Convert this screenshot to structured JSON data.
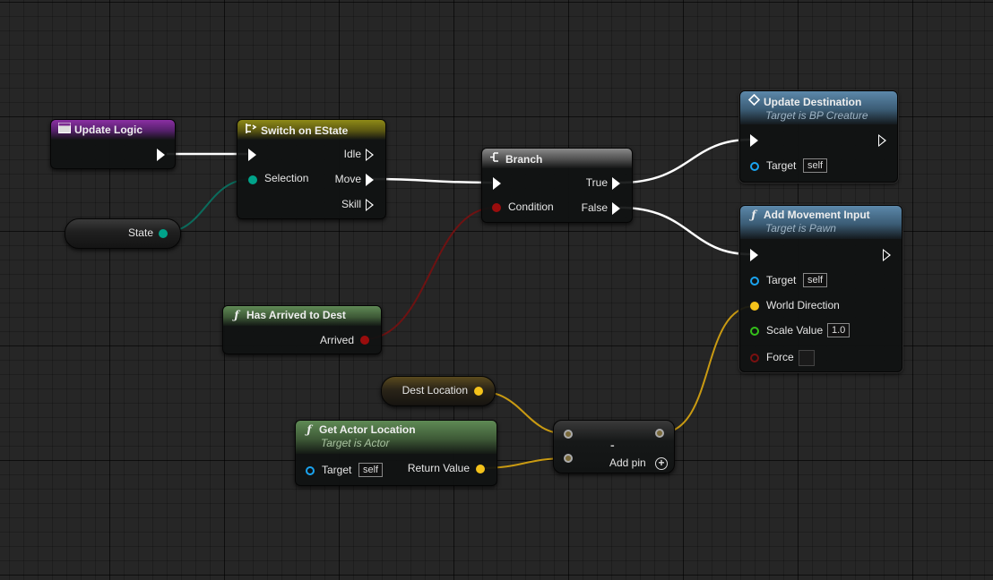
{
  "colors": {
    "exec": "#ffffff",
    "state_pin": "#00a38a",
    "bool_pin": "#9a0d0d",
    "vector_pin": "#f4c21b",
    "object_pin": "#1aa4f0",
    "float_pin": "#34c01a",
    "bool_pin_dark": "#7a1010"
  },
  "nodes": {
    "update_logic": {
      "title": "Update Logic",
      "icon": "event-icon"
    },
    "switch": {
      "title": "Switch on EState",
      "icon": "switch-icon",
      "pins": {
        "selection": "Selection",
        "idle": "Idle",
        "move": "Move",
        "skill": "Skill"
      }
    },
    "state_var": {
      "label": "State"
    },
    "branch": {
      "title": "Branch",
      "icon": "branch-icon",
      "pins": {
        "condition": "Condition",
        "true": "True",
        "false": "False"
      }
    },
    "has_arrived": {
      "title": "Has Arrived to Dest",
      "icon": "function-icon",
      "pin": "Arrived"
    },
    "update_dest": {
      "title": "Update Destination",
      "subtitle": "Target is BP Creature",
      "pins": {
        "target": "Target",
        "target_value": "self"
      }
    },
    "add_movement": {
      "title": "Add Movement Input",
      "subtitle": "Target is Pawn",
      "icon": "function-icon",
      "pins": {
        "target": "Target",
        "target_value": "self",
        "world_direction": "World Direction",
        "scale_value": "Scale Value",
        "scale_default": "1.0",
        "force": "Force"
      }
    },
    "dest_location": {
      "label": "Dest Location"
    },
    "get_actor_location": {
      "title": "Get Actor Location",
      "subtitle": "Target is Actor",
      "icon": "function-icon",
      "pins": {
        "target": "Target",
        "target_value": "self",
        "return_value": "Return Value"
      }
    },
    "subtract": {
      "symbol": "-",
      "add_pin": "Add pin"
    }
  }
}
